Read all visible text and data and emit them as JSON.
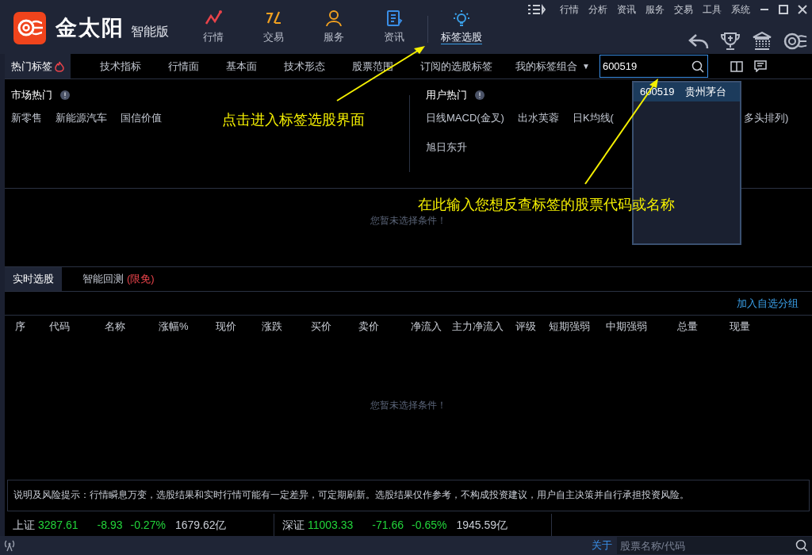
{
  "app": {
    "logo_text": "金太阳",
    "edition": "智能版"
  },
  "nav": [
    {
      "label": "行情",
      "kind": "chart",
      "selected": false
    },
    {
      "label": "交易",
      "kind": "trade",
      "selected": false
    },
    {
      "label": "服务",
      "kind": "person",
      "selected": false
    },
    {
      "label": "资讯",
      "kind": "doc",
      "selected": false
    },
    {
      "label": "标签选股",
      "kind": "bulb",
      "selected": true
    }
  ],
  "menu": [
    "行情",
    "分析",
    "资讯",
    "服务",
    "交易",
    "工具",
    "系统"
  ],
  "tag_tabs": [
    {
      "label": "热门标签",
      "selected": true,
      "hot": true
    },
    {
      "label": "技术指标",
      "selected": false,
      "hot": false
    },
    {
      "label": "行情面",
      "selected": false,
      "hot": false
    },
    {
      "label": "基本面",
      "selected": false,
      "hot": false
    },
    {
      "label": "技术形态",
      "selected": false,
      "hot": false
    },
    {
      "label": "股票范围",
      "selected": false,
      "hot": false
    },
    {
      "label": "订阅的选股标签",
      "selected": false,
      "hot": false
    }
  ],
  "combo": {
    "label": "我的标签组合",
    "arrow": "▼"
  },
  "search": {
    "value": "600519"
  },
  "suggestions": [
    {
      "code": "600519",
      "name": "贵州茅台",
      "selected": true
    }
  ],
  "market_hot": {
    "title": "市场热门",
    "tags": [
      "新零售",
      "新能源汽车",
      "国信价值"
    ]
  },
  "user_hot": {
    "title": "用户热门",
    "tags": [
      "日线MACD(金叉)",
      "出水芙蓉",
      "日K均线(",
      "多头排列)",
      "旭日东升"
    ]
  },
  "empty_message_top": "您暂未选择条件！",
  "result_tabs": [
    {
      "label": "实时选股",
      "selected": true
    },
    {
      "label": "智能回测",
      "selected": false,
      "badge": "(限免)"
    }
  ],
  "add_group_link": "加入自选分组",
  "table": {
    "columns": [
      "序",
      "代码",
      "名称",
      "涨幅%",
      "现价",
      "涨跌",
      "买价",
      "卖价",
      "净流入",
      "主力净流入",
      "评级",
      "短期强弱",
      "中期强弱",
      "总量",
      "现量"
    ]
  },
  "empty_message_table": "您暂未选择条件！",
  "disclaimer": "说明及风险提示：行情瞬息万变，选股结果和实时行情可能有一定差异，可定期刷新。选股结果仅作参考，不构成投资建议，用户自主决策并自行承担投资风险。",
  "indices": [
    {
      "name": "上证",
      "value": "3287.61",
      "change": "-8.93",
      "percent": "-0.27%",
      "amount": "1679.62亿"
    },
    {
      "name": "深证",
      "value": "11003.33",
      "change": "-71.66",
      "percent": "-0.65%",
      "amount": "1945.59亿"
    }
  ],
  "status_bar": {
    "about": "关于",
    "search_placeholder": "股票名称/代码"
  },
  "annotations": [
    {
      "text": "点击进入标签选股界面"
    },
    {
      "text": "在此输入您想反查标签的股票代码或名称"
    }
  ]
}
